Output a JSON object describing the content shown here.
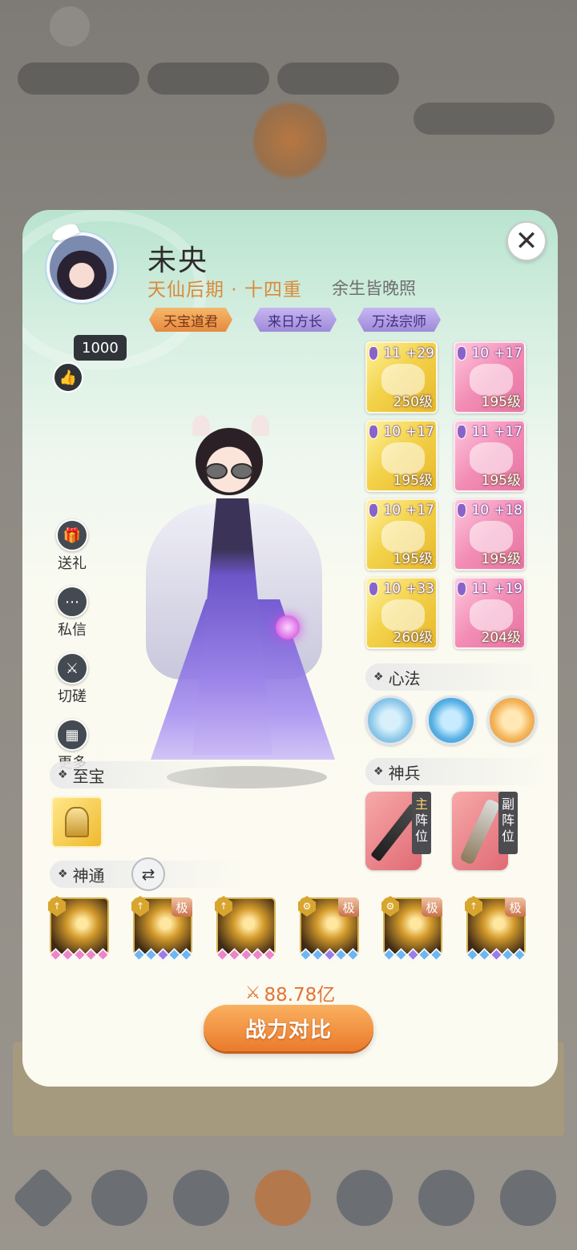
{
  "colors": {
    "panel_top": "#b9e4cf",
    "panel_bottom": "#fcfbf2",
    "realm_orange": "#d98a3a",
    "power_orange": "#e27436",
    "button_orange": "#eb7a2c"
  },
  "player": {
    "name": "未央",
    "realm": "天仙后期 · 十四重",
    "guild": "余生皆晚照",
    "titles": [
      "天宝道君",
      "来日方长",
      "万法宗师"
    ],
    "likes": "1000"
  },
  "side_actions": [
    {
      "label": "送礼",
      "icon": "gift-icon"
    },
    {
      "label": "私信",
      "icon": "chat-icon"
    },
    {
      "label": "切磋",
      "icon": "crossed-swords-icon"
    },
    {
      "label": "更多",
      "icon": "grid-icon"
    }
  ],
  "equipment": [
    {
      "stars": "11",
      "plus": "+29",
      "level": "250级",
      "rarity": "gold",
      "icon": "spear-icon"
    },
    {
      "stars": "10",
      "plus": "+17",
      "level": "195级",
      "rarity": "pink",
      "icon": "crown-icon"
    },
    {
      "stars": "10",
      "plus": "+17",
      "level": "195级",
      "rarity": "gold",
      "icon": "robe-icon"
    },
    {
      "stars": "11",
      "plus": "+17",
      "level": "195级",
      "rarity": "pink",
      "icon": "skirt-icon"
    },
    {
      "stars": "10",
      "plus": "+17",
      "level": "195级",
      "rarity": "gold",
      "icon": "bracer-icon"
    },
    {
      "stars": "10",
      "plus": "+18",
      "level": "195级",
      "rarity": "pink",
      "icon": "boots-icon"
    },
    {
      "stars": "10",
      "plus": "+33",
      "level": "260级",
      "rarity": "gold",
      "icon": "ring-icon"
    },
    {
      "stars": "11",
      "plus": "+19",
      "level": "204级",
      "rarity": "pink",
      "icon": "necklace-icon"
    }
  ],
  "sections": {
    "xinfa": "心法",
    "shenbing": "神兵",
    "zhibao": "至宝",
    "shentong": "神通"
  },
  "weapons": [
    {
      "role": "主",
      "position": [
        "阵",
        "位"
      ],
      "icon": "sword-icon"
    },
    {
      "role": "副",
      "position": [
        "阵",
        "位"
      ],
      "icon": "scroll-icon"
    }
  ],
  "skills": [
    {
      "extreme": "",
      "gems": [
        "pink",
        "pink",
        "pink",
        "pink",
        "pink"
      ]
    },
    {
      "extreme": "极",
      "gems": [
        "blue",
        "blue",
        "purple",
        "blue",
        "blue"
      ]
    },
    {
      "extreme": "",
      "gems": [
        "pink",
        "pink",
        "pink",
        "pink",
        "pink"
      ]
    },
    {
      "extreme": "极",
      "gems": [
        "blue",
        "blue",
        "purple",
        "blue",
        "blue"
      ]
    },
    {
      "extreme": "极",
      "gems": [
        "blue",
        "blue",
        "purple",
        "blue",
        "blue"
      ]
    },
    {
      "extreme": "极",
      "gems": [
        "blue",
        "blue",
        "purple",
        "blue",
        "blue"
      ]
    }
  ],
  "power": {
    "value": "88.78亿",
    "compare_label": "战力对比"
  },
  "close_label": "✕"
}
